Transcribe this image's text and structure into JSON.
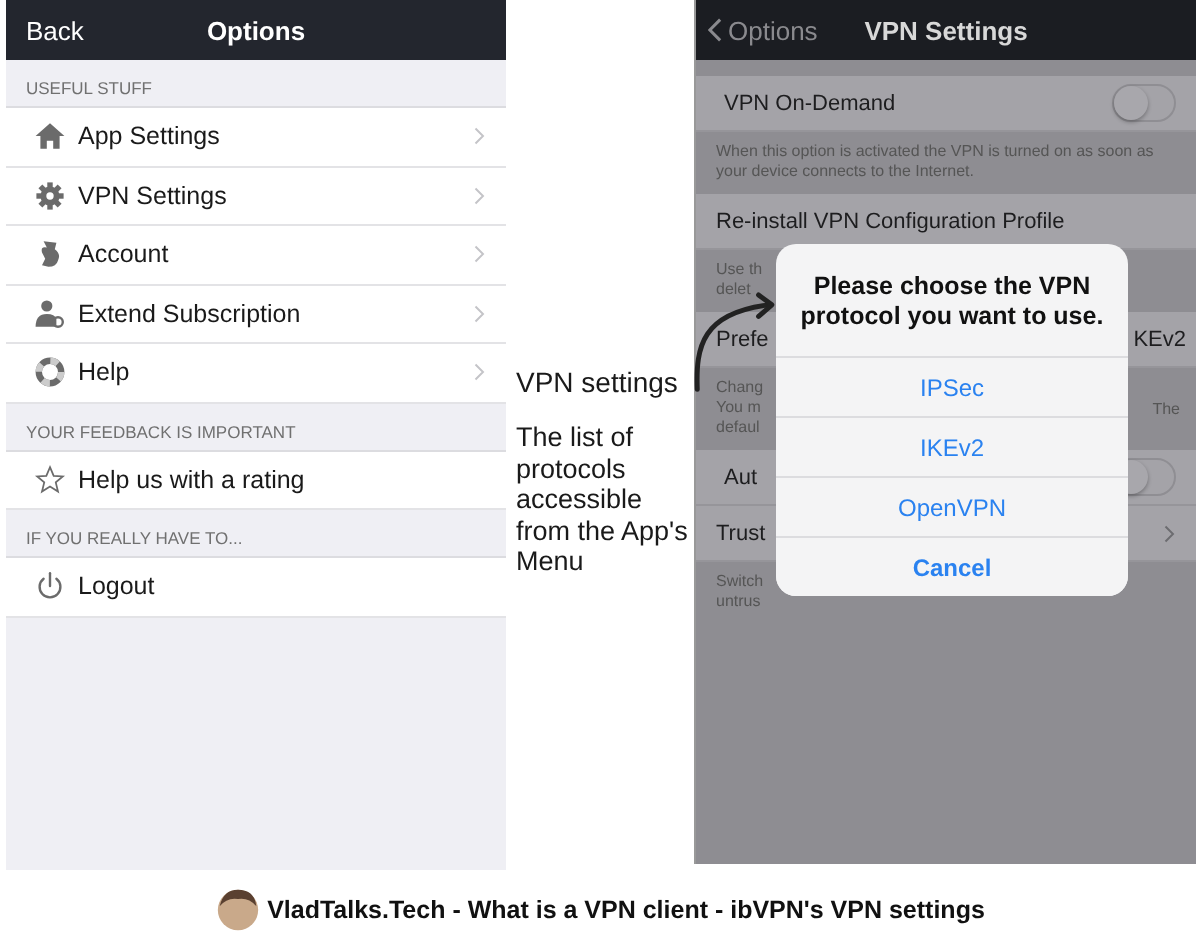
{
  "left_screen": {
    "nav": {
      "back": "Back",
      "title": "Options"
    },
    "sections": [
      {
        "header": "USEFUL STUFF",
        "items": [
          {
            "label": "App Settings",
            "chevron": true
          },
          {
            "label": "VPN Settings",
            "chevron": true
          },
          {
            "label": "Account",
            "chevron": true
          },
          {
            "label": "Extend Subscription",
            "chevron": true
          },
          {
            "label": "Help",
            "chevron": true
          }
        ]
      },
      {
        "header": "YOUR FEEDBACK IS IMPORTANT",
        "items": [
          {
            "label": "Help us with a rating",
            "chevron": false
          }
        ]
      },
      {
        "header": "IF YOU REALLY HAVE TO...",
        "items": [
          {
            "label": "Logout",
            "chevron": false
          }
        ]
      }
    ]
  },
  "annotation": {
    "label": "VPN settings",
    "note": "The list of protocols accessible from the App's Menu"
  },
  "right_screen": {
    "nav": {
      "back": "Options",
      "title": "VPN Settings"
    },
    "rows": [
      {
        "kind": "toggle",
        "label": "VPN On-Demand",
        "on": false
      },
      {
        "kind": "footer",
        "lines": [
          "When this option is activated the VPN is turned on as soon as your device connects to the Internet."
        ]
      },
      {
        "kind": "row",
        "label": "Re-install VPN Configuration Profile"
      },
      {
        "kind": "footer",
        "lines": [
          "Use th",
          "delet"
        ]
      },
      {
        "kind": "value",
        "label": "Prefe",
        "value": "KEv2"
      },
      {
        "kind": "footer",
        "lines": [
          "Chang",
          "You m",
          "defaul"
        ],
        "aside": "The"
      },
      {
        "kind": "toggle",
        "label": "Aut",
        "on": false
      },
      {
        "kind": "link",
        "label": "Trust"
      },
      {
        "kind": "footer",
        "lines": [
          "Switch",
          "untrus"
        ]
      }
    ],
    "alert": {
      "title": "Please choose the VPN protocol you want to use.",
      "options": [
        "IPSec",
        "IKEv2",
        "OpenVPN"
      ],
      "cancel": "Cancel"
    }
  },
  "caption": "VladTalks.Tech - What is a VPN client - ibVPN's VPN settings"
}
